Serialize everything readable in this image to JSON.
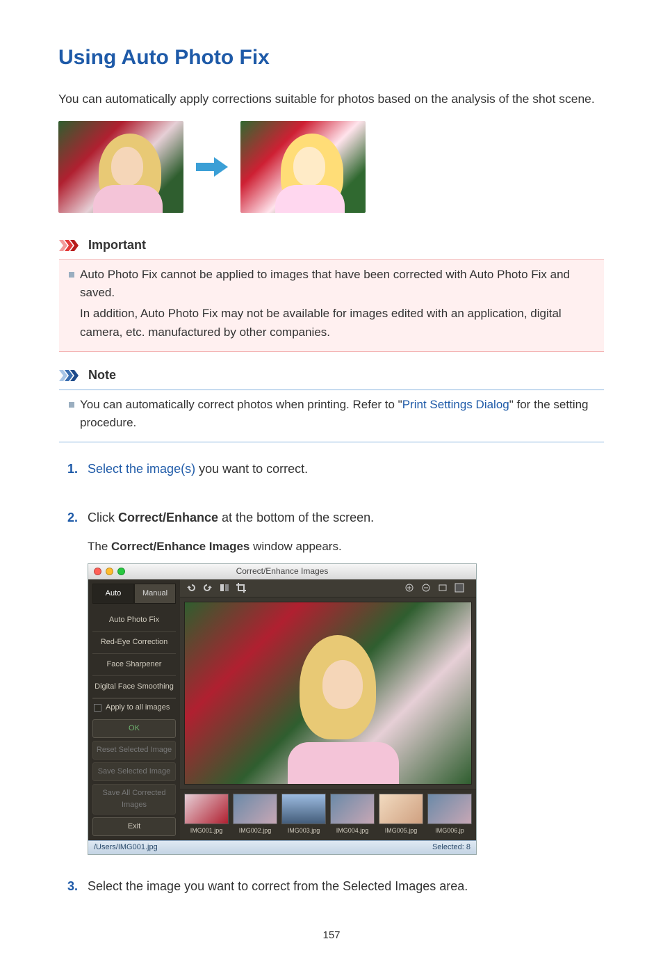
{
  "title": "Using Auto Photo Fix",
  "intro": "You can automatically apply corrections suitable for photos based on the analysis of the shot scene.",
  "important": {
    "heading": "Important",
    "bullet_lead": "Auto Photo Fix cannot be applied to images that have been corrected with Auto Photo Fix and saved.",
    "bullet_more": "In addition, Auto Photo Fix may not be available for images edited with an application, digital camera, etc. manufactured by other companies."
  },
  "note": {
    "heading": "Note",
    "bullet_pre": "You can automatically correct photos when printing. Refer to \"",
    "bullet_link": "Print Settings Dialog",
    "bullet_post": "\" for the setting procedure."
  },
  "steps": {
    "s1": {
      "num": "1.",
      "link": "Select the image(s)",
      "rest": " you want to correct."
    },
    "s2": {
      "num": "2.",
      "pre": "Click ",
      "bold": "Correct/Enhance",
      "post": " at the bottom of the screen.",
      "sub_pre": "The ",
      "sub_bold": "Correct/Enhance Images",
      "sub_post": " window appears."
    },
    "s3": {
      "num": "3.",
      "text": "Select the image you want to correct from the Selected Images area."
    }
  },
  "app": {
    "window_title": "Correct/Enhance Images",
    "tabs": {
      "auto": "Auto",
      "manual": "Manual"
    },
    "side_items": [
      "Auto Photo Fix",
      "Red-Eye Correction",
      "Face Sharpener",
      "Digital Face Smoothing"
    ],
    "apply_all": "Apply to all images",
    "ok": "OK",
    "reset": "Reset Selected Image",
    "save_sel": "Save Selected Image",
    "save_all": "Save All Corrected Images",
    "exit": "Exit",
    "thumbs": [
      "IMG001.jpg",
      "IMG002.jpg",
      "IMG003.jpg",
      "IMG004.jpg",
      "IMG005.jpg",
      "IMG006.jp"
    ],
    "status_left": "/Users/IMG001.jpg",
    "status_right": "Selected: 8"
  },
  "page_number": "157"
}
